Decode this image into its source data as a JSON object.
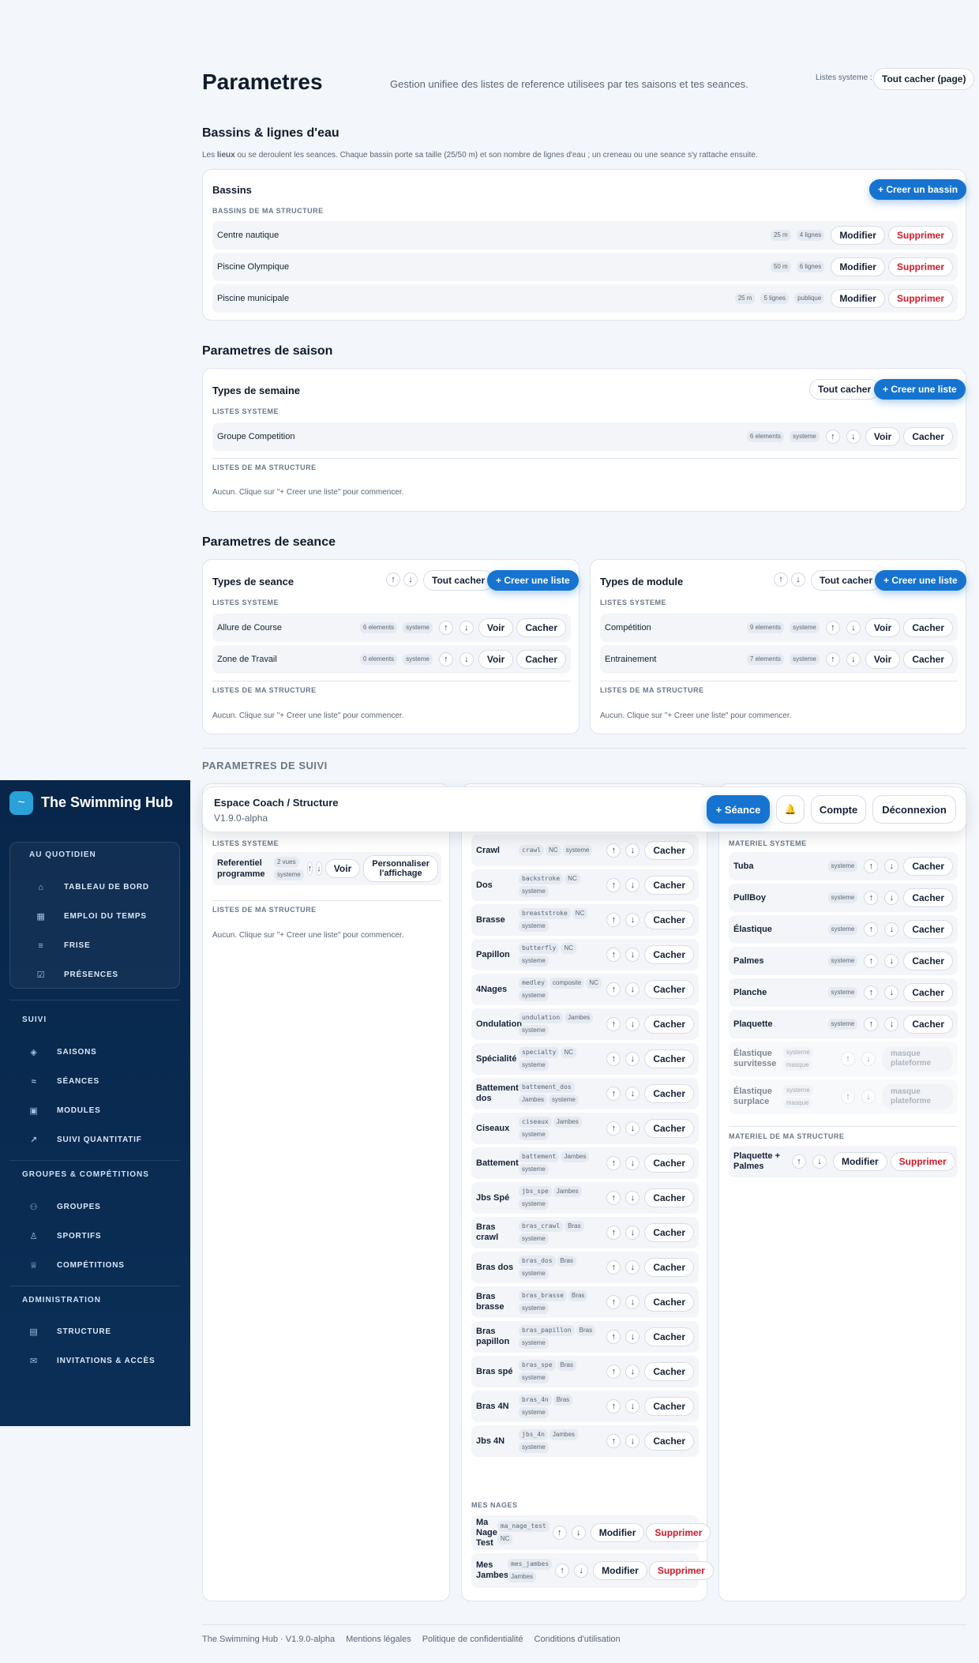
{
  "header": {
    "title": "Parametres",
    "subtitle": "Gestion unifiee des listes de reference utilisees par tes saisons et tes seances.",
    "system_lists_label": "Listes systeme :",
    "hide_all_page": "Tout cacher (page)"
  },
  "basins": {
    "section_title": "Bassins & lignes d'eau",
    "desc_pre": "Les ",
    "desc_bold": "lieux",
    "desc_post": " ou se deroulent les seances. Chaque bassin porte sa taille (25/50 m) et son nombre de lignes d'eau ; un creneau ou une seance s'y rattache ensuite.",
    "card_title": "Bassins",
    "create_btn": "+ Creer un bassin",
    "caption": "BASSINS DE MA STRUCTURE",
    "items": [
      {
        "name": "Centre nautique",
        "tags": [
          "25 m",
          "4 lignes"
        ]
      },
      {
        "name": "Piscine Olympique",
        "tags": [
          "50 m",
          "6 lignes"
        ]
      },
      {
        "name": "Piscine municipale",
        "tags": [
          "25 m",
          "5 lignes",
          "publique"
        ]
      }
    ],
    "edit": "Modifier",
    "delete": "Supprimer"
  },
  "season": {
    "section_title": "Parametres de saison",
    "card_title": "Types de semaine",
    "hide_all": "Tout cacher",
    "create": "+ Creer une liste",
    "sys_caption": "LISTES SYSTEME",
    "sys_items": [
      {
        "name": "Groupe Competition",
        "tags": [
          "6 elements",
          "systeme"
        ]
      }
    ],
    "struct_caption": "LISTES DE MA STRUCTURE",
    "empty": "Aucun. Clique sur \"+ Creer une liste\" pour commencer."
  },
  "common": {
    "view": "Voir",
    "hide": "Cacher",
    "up": "↑",
    "down": "↓"
  },
  "seance": {
    "section_title": "Parametres de seance",
    "left": {
      "title": "Types de seance",
      "hide_all": "Tout cacher",
      "create": "+ Creer une liste",
      "sys_caption": "LISTES SYSTEME",
      "items": [
        {
          "name": "Allure de Course",
          "tags": [
            "6 elements",
            "systeme"
          ]
        },
        {
          "name": "Zone de Travail",
          "tags": [
            "0 elements",
            "systeme"
          ]
        }
      ],
      "struct_caption": "LISTES DE MA STRUCTURE",
      "empty": "Aucun. Clique sur \"+ Creer une liste\" pour commencer."
    },
    "right": {
      "title": "Types de module",
      "hide_all": "Tout cacher",
      "create": "+ Creer une liste",
      "sys_caption": "LISTES SYSTEME",
      "items": [
        {
          "name": "Compétition",
          "tags": [
            "9 elements",
            "systeme"
          ]
        },
        {
          "name": "Entrainement",
          "tags": [
            "7 elements",
            "systeme"
          ]
        }
      ],
      "struct_caption": "LISTES DE MA STRUCTURE",
      "empty": "Aucun. Clique sur \"+ Creer une liste\" pour commencer."
    }
  },
  "suivi": {
    "section_title": "PARAMETRES DE SUIVI",
    "col1": {
      "sys_caption": "LISTES SYSTEME",
      "item_name": "Referentiel programme",
      "item_tags": [
        "2 vues",
        "systeme"
      ],
      "customize": "Personnaliser l'affichage",
      "struct_caption": "LISTES DE MA STRUCTURE",
      "empty": "Aucun. Clique sur \"+ Creer une liste\" pour commencer."
    },
    "nages": [
      {
        "name": "Crawl",
        "tags": [
          "crawl",
          "NC",
          "systeme"
        ]
      },
      {
        "name": "Dos",
        "tags": [
          "backstroke",
          "NC",
          "systeme"
        ]
      },
      {
        "name": "Brasse",
        "tags": [
          "breaststroke",
          "NC",
          "systeme"
        ]
      },
      {
        "name": "Papillon",
        "tags": [
          "butterfly",
          "NC",
          "systeme"
        ]
      },
      {
        "name": "4Nages",
        "tags": [
          "medley",
          "composite",
          "NC",
          "systeme"
        ]
      },
      {
        "name": "Ondulation",
        "tags": [
          "undulation",
          "Jambes",
          "systeme"
        ]
      },
      {
        "name": "Spécialité",
        "tags": [
          "specialty",
          "NC",
          "systeme"
        ]
      },
      {
        "name": "Battement dos",
        "tags": [
          "battement_dos",
          "Jambes",
          "systeme"
        ]
      },
      {
        "name": "Ciseaux",
        "tags": [
          "ciseaux",
          "Jambes",
          "systeme"
        ]
      },
      {
        "name": "Battement",
        "tags": [
          "battement",
          "Jambes",
          "systeme"
        ]
      },
      {
        "name": "Jbs Spé",
        "tags": [
          "jbs_spe",
          "Jambes",
          "systeme"
        ]
      },
      {
        "name": "Bras crawl",
        "tags": [
          "bras_crawl",
          "Bras",
          "systeme"
        ]
      },
      {
        "name": "Bras dos",
        "tags": [
          "bras_dos",
          "Bras",
          "systeme"
        ]
      },
      {
        "name": "Bras brasse",
        "tags": [
          "bras_brasse",
          "Bras",
          "systeme"
        ]
      },
      {
        "name": "Bras papillon",
        "tags": [
          "bras_papillon",
          "Bras",
          "systeme"
        ]
      },
      {
        "name": "Bras spé",
        "tags": [
          "bras_spe",
          "Bras",
          "systeme"
        ]
      },
      {
        "name": "Bras 4N",
        "tags": [
          "bras_4n",
          "Bras",
          "systeme"
        ]
      },
      {
        "name": "Jbs 4N",
        "tags": [
          "jbs_4n",
          "Jambes",
          "systeme"
        ]
      }
    ],
    "my_nages_caption": "MES NAGES",
    "my_nages": [
      {
        "name": "Ma Nage Test",
        "tags": [
          "ma_nage_test",
          "NC"
        ]
      },
      {
        "name": "Mes Jambes",
        "tags": [
          "mes_jambes",
          "Jambes"
        ]
      }
    ],
    "materiel_caption": "MATERIEL SYSTEME",
    "materiel": [
      {
        "name": "Tuba",
        "tag": "systeme"
      },
      {
        "name": "PullBoy",
        "tag": "systeme"
      },
      {
        "name": "Élastique",
        "tag": "systeme"
      },
      {
        "name": "Palmes",
        "tag": "systeme"
      },
      {
        "name": "Planche",
        "tag": "systeme"
      },
      {
        "name": "Plaquette",
        "tag": "systeme"
      }
    ],
    "materiel_masked": [
      {
        "name": "Élastique survitesse",
        "tags": [
          "systeme",
          "masque"
        ],
        "label": "masque plateforme"
      },
      {
        "name": "Élastique surplace",
        "tags": [
          "systeme",
          "masque"
        ],
        "label": "masque plateforme"
      }
    ],
    "my_materiel_caption": "MATERIEL DE MA STRUCTURE",
    "my_materiel": [
      {
        "name": "Plaquette + Palmes"
      }
    ]
  },
  "topbar": {
    "title": "Espace Coach / Structure",
    "version": "V1.9.0-alpha",
    "new_session": "+ Séance",
    "bell": "🔔",
    "account": "Compte",
    "logout": "Déconnexion"
  },
  "sidebar": {
    "brand": "The Swimming Hub",
    "logo_glyph": "~",
    "daily_caption": "AU QUOTIDIEN",
    "daily": [
      {
        "label": "TABLEAU DE BORD",
        "icon": "home-icon"
      },
      {
        "label": "EMPLOI DU TEMPS",
        "icon": "calendar-icon"
      },
      {
        "label": "FRISE",
        "icon": "timeline-icon"
      },
      {
        "label": "PRÉSENCES",
        "icon": "checklist-icon"
      }
    ],
    "suivi_caption": "SUIVI",
    "suivi": [
      {
        "label": "SAISONS",
        "icon": "layers-icon"
      },
      {
        "label": "SÉANCES",
        "icon": "waves-icon"
      },
      {
        "label": "MODULES",
        "icon": "grid-icon"
      },
      {
        "label": "SUIVI QUANTITATIF",
        "icon": "trend-icon"
      }
    ],
    "groups_caption": "GROUPES & COMPÉTITIONS",
    "groups": [
      {
        "label": "GROUPES",
        "icon": "users-icon"
      },
      {
        "label": "SPORTIFS",
        "icon": "user-icon"
      },
      {
        "label": "COMPÉTITIONS",
        "icon": "trophy-icon"
      }
    ],
    "admin_caption": "ADMINISTRATION",
    "admin": [
      {
        "label": "STRUCTURE",
        "icon": "document-icon"
      },
      {
        "label": "INVITATIONS & ACCÈS",
        "icon": "mail-icon"
      }
    ]
  },
  "footer": {
    "brand": "The Swimming Hub · V1.9.0-alpha",
    "legal": "Mentions légales",
    "privacy": "Politique de confidentialité",
    "terms": "Conditions d'utilisation"
  }
}
